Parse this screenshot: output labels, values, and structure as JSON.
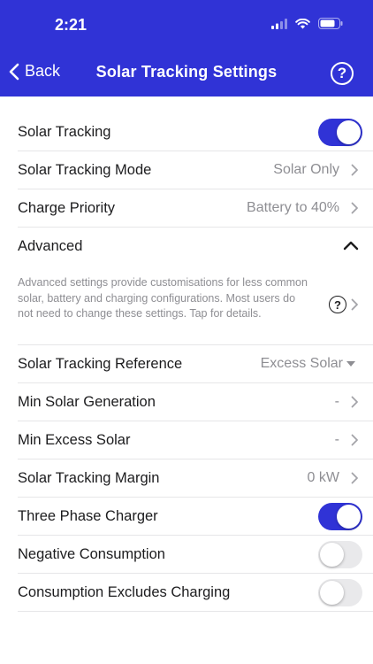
{
  "status_bar": {
    "time": "2:21"
  },
  "nav": {
    "back_label": "Back",
    "title": "Solar Tracking Settings",
    "help_symbol": "?"
  },
  "colors": {
    "accent": "#3033d6",
    "secondary_text": "#8e8e93",
    "toggle_off": "#e9e9eb"
  },
  "settings": {
    "solar_tracking": {
      "label": "Solar Tracking",
      "on": true
    },
    "tracking_mode": {
      "label": "Solar Tracking Mode",
      "value": "Solar Only"
    },
    "charge_priority": {
      "label": "Charge Priority",
      "value": "Battery to 40%"
    },
    "advanced": {
      "label": "Advanced",
      "expanded": true,
      "description": "Advanced settings provide customisations for less common solar, battery and charging configurations. Most users do not need to change these settings. Tap for details.",
      "help_symbol": "?"
    },
    "tracking_reference": {
      "label": "Solar Tracking Reference",
      "value": "Excess Solar"
    },
    "min_generation": {
      "label": "Min Solar Generation",
      "value": "-"
    },
    "min_excess": {
      "label": "Min Excess Solar",
      "value": "-"
    },
    "tracking_margin": {
      "label": "Solar Tracking Margin",
      "value": "0 kW"
    },
    "three_phase": {
      "label": "Three Phase Charger",
      "on": true
    },
    "negative_consumption": {
      "label": "Negative Consumption",
      "on": false
    },
    "excludes_charging": {
      "label": "Consumption Excludes Charging",
      "on": false
    }
  }
}
